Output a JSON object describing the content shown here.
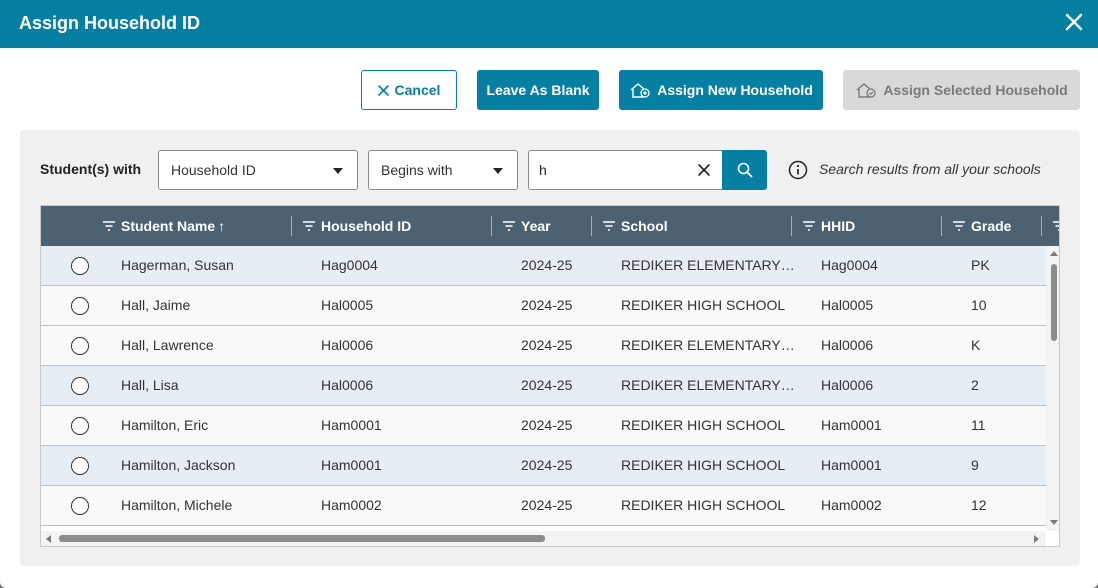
{
  "dialog": {
    "title": "Assign Household ID"
  },
  "actions": {
    "cancel_label": "Cancel",
    "leave_blank_label": "Leave As Blank",
    "assign_new_label": "Assign New Household",
    "assign_selected_label": "Assign Selected Household"
  },
  "search": {
    "with_label": "Student(s) with",
    "field_value": "Household ID",
    "operator_value": "Begins with",
    "query_value": "h",
    "info_text": "Search results from all your schools"
  },
  "grid": {
    "columns": [
      "Student Name",
      "Household ID",
      "Year",
      "School",
      "HHID",
      "Grade"
    ],
    "sort_indicator": "↑",
    "rows": [
      {
        "name": "Hagerman, Susan",
        "household": "Hag0004",
        "year": "2024-25",
        "school": "REDIKER ELEMENTARY…",
        "hhid": "Hag0004",
        "grade": "PK"
      },
      {
        "name": "Hall, Jaime",
        "household": "Hal0005",
        "year": "2024-25",
        "school": "REDIKER HIGH SCHOOL",
        "hhid": "Hal0005",
        "grade": "10"
      },
      {
        "name": "Hall, Lawrence",
        "household": "Hal0006",
        "year": "2024-25",
        "school": "REDIKER ELEMENTARY…",
        "hhid": "Hal0006",
        "grade": "K"
      },
      {
        "name": "Hall, Lisa",
        "household": "Hal0006",
        "year": "2024-25",
        "school": "REDIKER ELEMENTARY…",
        "hhid": "Hal0006",
        "grade": "2"
      },
      {
        "name": "Hamilton, Eric",
        "household": "Ham0001",
        "year": "2024-25",
        "school": "REDIKER HIGH SCHOOL",
        "hhid": "Ham0001",
        "grade": "11"
      },
      {
        "name": "Hamilton, Jackson",
        "household": "Ham0001",
        "year": "2024-25",
        "school": "REDIKER HIGH SCHOOL",
        "hhid": "Ham0001",
        "grade": "9"
      },
      {
        "name": "Hamilton, Michele",
        "household": "Ham0002",
        "year": "2024-25",
        "school": "REDIKER HIGH SCHOOL",
        "hhid": "Ham0002",
        "grade": "12"
      }
    ]
  },
  "colors": {
    "accent": "#067fa3",
    "header_bg": "#4c6273",
    "disabled_bg": "#d9d9d9"
  },
  "icons": [
    "close-icon",
    "cancel-x-icon",
    "house-add-icon",
    "house-check-icon",
    "chevron-down-icon",
    "clear-icon",
    "search-icon",
    "info-icon",
    "filter-icon",
    "sort-arrow-icon"
  ]
}
